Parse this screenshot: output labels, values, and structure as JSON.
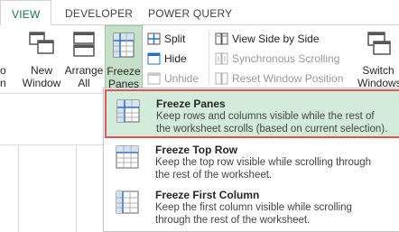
{
  "tabs": [
    {
      "label": "VIEW",
      "active": true
    },
    {
      "label": "DEVELOPER",
      "active": false
    },
    {
      "label": "POWER QUERY",
      "active": false
    }
  ],
  "ribbon": {
    "left_partial_label": [
      "o",
      "n"
    ],
    "new_window": [
      "New",
      "Window"
    ],
    "arrange_all": [
      "Arrange",
      "All"
    ],
    "freeze_panes": [
      "Freeze",
      "Panes ▾"
    ],
    "split": "Split",
    "hide": "Hide",
    "unhide": "Unhide",
    "view_side_by_side": "View Side by Side",
    "synchronous_scrolling": "Synchronous Scrolling",
    "reset_window_position": "Reset Window Position",
    "switch_windows": [
      "Switch",
      "Windows"
    ]
  },
  "menu": {
    "items": [
      {
        "title": "Freeze Panes",
        "desc_line1": "Keep rows and columns visible while the rest of",
        "desc_line2": "the worksheet scrolls (based on current selection).",
        "highlighted": true
      },
      {
        "title": "Freeze Top Row",
        "desc_line1": "Keep the top row visible while scrolling through",
        "desc_line2": "the rest of the worksheet.",
        "highlighted": false
      },
      {
        "title": "Freeze First Column",
        "desc_line1": "Keep the first column visible while scrolling",
        "desc_line2": "through the rest of the worksheet.",
        "highlighted": false
      }
    ]
  },
  "colors": {
    "accent": "#217346",
    "highlight_fill": "#d3ecd9",
    "highlight_border": "#e05555"
  },
  "icons": [
    "new-window-icon",
    "arrange-all-icon",
    "freeze-panes-icon",
    "split-icon",
    "hide-icon",
    "unhide-icon",
    "side-by-side-icon",
    "sync-scroll-icon",
    "reset-window-icon",
    "switch-windows-icon"
  ]
}
